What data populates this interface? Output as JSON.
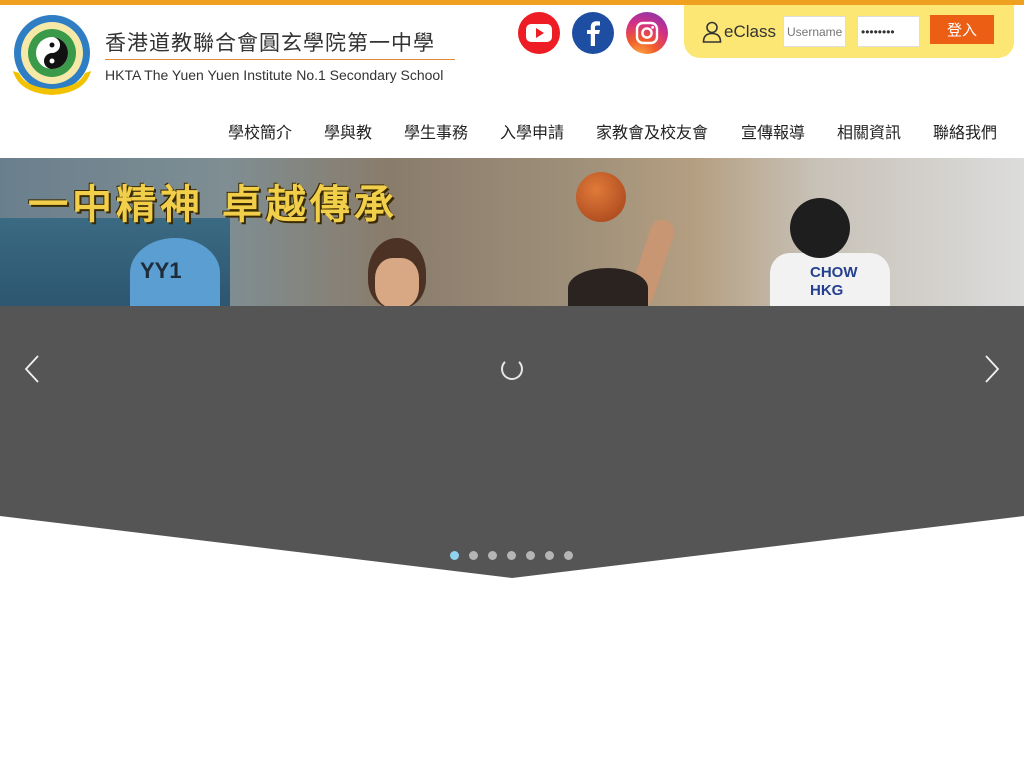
{
  "school": {
    "name_cn": "香港道教聯合會圓玄學院第一中學",
    "name_en": "HKTA The Yuen Yuen Institute No.1 Secondary School"
  },
  "social": [
    {
      "name": "youtube-icon",
      "color": "#ee1c24"
    },
    {
      "name": "facebook-icon",
      "color": "#1e4ea1"
    },
    {
      "name": "instagram-icon",
      "color": "#d22f86"
    }
  ],
  "login": {
    "label": "eClass",
    "username_placeholder": "Username",
    "password_value": "••••••••",
    "button": "登入"
  },
  "nav": [
    {
      "label": "學校簡介"
    },
    {
      "label": "學與教"
    },
    {
      "label": "學生事務"
    },
    {
      "label": "入學申請"
    },
    {
      "label": "家教會及校友會"
    },
    {
      "label": "宣傳報導"
    },
    {
      "label": "相關資訊"
    },
    {
      "label": "聯絡我們"
    }
  ],
  "banner": {
    "slogan": "一中精神 卓越傳承",
    "swimmer_cap": "YY1",
    "fencer_text_1": "CHOW",
    "fencer_text_2": "HKG"
  },
  "carousel": {
    "slide_count": 7,
    "active_index": 0
  },
  "colors": {
    "accent": "#f0a020",
    "login_bg": "#fce775",
    "login_button": "#ec5e14",
    "hero_bg": "#555555"
  }
}
